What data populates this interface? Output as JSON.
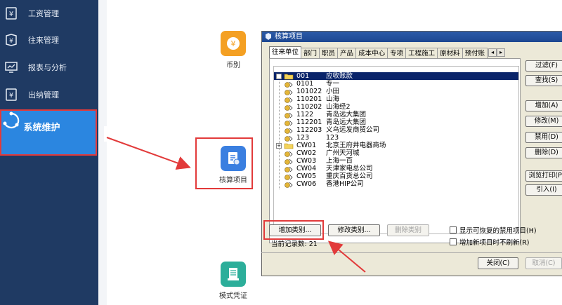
{
  "sidebar": {
    "items": [
      {
        "label": "工资管理",
        "icon": "yen-icon"
      },
      {
        "label": "往来管理",
        "icon": "transfer-icon"
      },
      {
        "label": "报表与分析",
        "icon": "chart-icon"
      },
      {
        "label": "出纳管理",
        "icon": "cashier-icon"
      }
    ],
    "active": {
      "label": "系统维护",
      "icon": "system-maintenance-icon"
    }
  },
  "tiles": {
    "currency": {
      "label": "币别",
      "icon": "currency-icon",
      "color": "#f4a023"
    },
    "accounting": {
      "label": "核算项目",
      "icon": "accounting-item-icon",
      "color": "#3a7fe0"
    },
    "template": {
      "label": "模式凭证",
      "icon": "template-voucher-icon",
      "color": "#2cae9a"
    }
  },
  "dialog": {
    "title": "核算项目",
    "tabs": [
      "往来单位",
      "部门",
      "职员",
      "产品",
      "成本中心",
      "专项",
      "工程施工",
      "原材料",
      "预付账"
    ],
    "tab_scroll_left": "◂",
    "tab_scroll_right": "▸",
    "tree": [
      {
        "code": "001",
        "name": "应收账款",
        "expander": "+"
      },
      {
        "code": "0101",
        "name": "专一"
      },
      {
        "code": "101022",
        "name": "小田"
      },
      {
        "code": "110201",
        "name": "山海"
      },
      {
        "code": "110202",
        "name": "山海经2"
      },
      {
        "code": "1122",
        "name": "青岛远大集团"
      },
      {
        "code": "112201",
        "name": "青岛远大集团"
      },
      {
        "code": "112203",
        "name": "义乌远发商贸公司"
      },
      {
        "code": "123",
        "name": "123"
      },
      {
        "code": "CW01",
        "name": "北京王府井电器商场",
        "expander": "+"
      },
      {
        "code": "CW02",
        "name": "广州天河城"
      },
      {
        "code": "CW03",
        "name": "上海一百"
      },
      {
        "code": "CW04",
        "name": "天津家电总公司"
      },
      {
        "code": "CW05",
        "name": "重庆百货总公司"
      },
      {
        "code": "CW06",
        "name": "香港HIP公司"
      }
    ],
    "right_buttons": [
      "过滤(F)",
      "查找(S)",
      "增加(A)",
      "修改(M)",
      "禁用(D)",
      "删除(D)",
      "浏览打印(P)",
      "引入(I)"
    ],
    "bottom_buttons": {
      "add_category": "增加类别...",
      "modify_category": "修改类别...",
      "delete_category": "删除类别"
    },
    "checkboxes": {
      "show_restorable": "显示可恢复的禁用项目(H)",
      "no_refresh": "增加新项目时不刷新(R)"
    },
    "record_count": "当前记录数: 21",
    "close": "关闭(C)",
    "cancel": "取消(C)"
  },
  "colors": {
    "sidebar": "#1f3a63",
    "active": "#2b86e0",
    "highlight": "#e23a3a",
    "selected_row": "#0a246a"
  }
}
